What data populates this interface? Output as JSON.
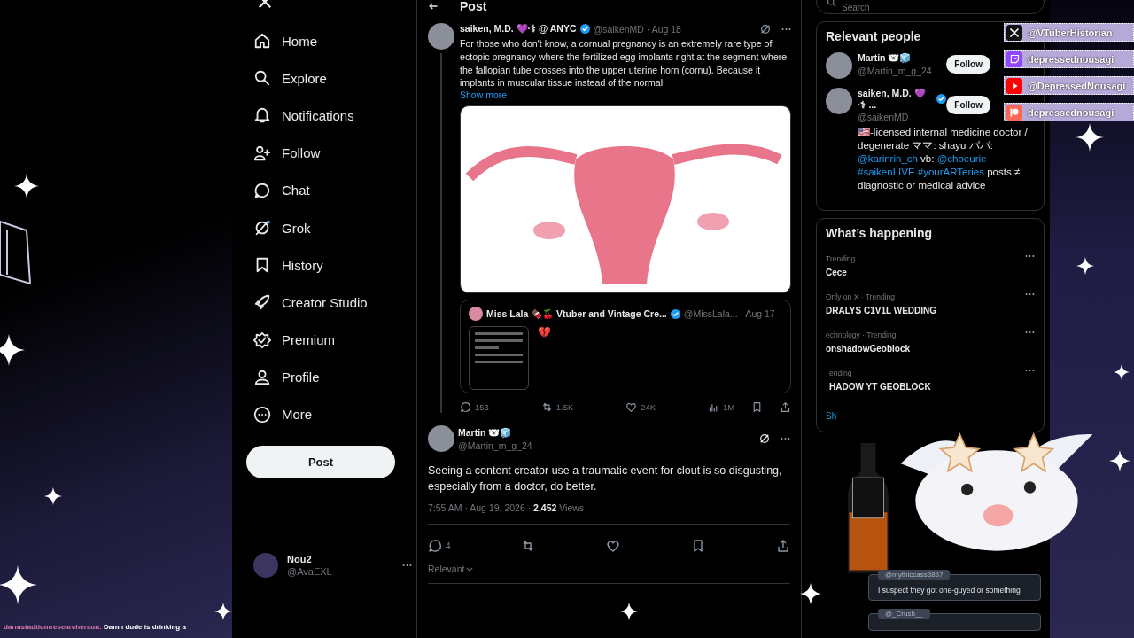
{
  "nav": {
    "items": [
      {
        "label": "Home",
        "kind": "home"
      },
      {
        "label": "Explore",
        "kind": "search"
      },
      {
        "label": "Notifications",
        "kind": "bell"
      },
      {
        "label": "Follow",
        "kind": "follow"
      },
      {
        "label": "Chat",
        "kind": "chat"
      },
      {
        "label": "Grok",
        "kind": "grok"
      },
      {
        "label": "History",
        "kind": "bookmark"
      },
      {
        "label": "Creator Studio",
        "kind": "rocket"
      },
      {
        "label": "Premium",
        "kind": "premium"
      },
      {
        "label": "Profile",
        "kind": "person"
      },
      {
        "label": "More",
        "kind": "more"
      }
    ],
    "post_button": "Post",
    "account": {
      "name": "Nou2",
      "handle": "@AvaEXL"
    }
  },
  "header": {
    "title": "Post"
  },
  "search": {
    "placeholder": "Search"
  },
  "post": {
    "name": "saiken, M.D. 💜·⚕ @ ANYC",
    "handle": "@saikenMD · Aug 18",
    "text": "For those who don't know, a cornual pregnancy is an extremely rare type of ectopic pregnancy where the fertilized egg implants right at the segment where the fallopian tube crosses into the upper uterine horn (cornu). Because it implants in muscular tissue instead of the normal",
    "show_more": "Show more",
    "quote": {
      "name": "Miss Lala 🍫🍒 Vtuber and Vintage Cre...",
      "handle": "@MissLala... · Aug 17",
      "emoji": "💔"
    },
    "stats": [
      {
        "kind": "reply",
        "count": "153"
      },
      {
        "kind": "repost",
        "count": "1.5K"
      },
      {
        "kind": "like",
        "count": "24K"
      },
      {
        "kind": "views",
        "count": "1M"
      },
      {
        "kind": "bookmark"
      },
      {
        "kind": "share"
      }
    ]
  },
  "reply": {
    "name": "Martin 🐻‍❄️🧊",
    "handle": "@Martin_m_g_24",
    "text": "Seeing a content creator use a traumatic event for clout is so disgusting, especially from a doctor, do better.",
    "time": "7:55 AM · Aug 19, 2026 · ",
    "views": "2,452",
    "views_label": "Views",
    "stats": [
      {
        "kind": "reply",
        "count": "4"
      },
      {
        "kind": "repost"
      },
      {
        "kind": "like"
      },
      {
        "kind": "bookmark"
      },
      {
        "kind": "share"
      }
    ],
    "sort": "Relevant"
  },
  "relevant_people": {
    "title": "Relevant people",
    "people": [
      {
        "name": "Martin 🐻‍❄️🧊",
        "handle": "@Martin_m_g_24",
        "button": "Follow",
        "verified": false
      },
      {
        "name": "saiken, M.D. 💜·⚕ ...",
        "handle": "@saikenMD",
        "button": "Follow",
        "verified": true,
        "bio": [
          {
            "kind": "plain",
            "text": "🇺🇸-licensed internal medicine doctor / degenerate ママ: shayu パパ: "
          },
          {
            "kind": "link",
            "text": "@karinrin_ch"
          },
          {
            "kind": "plain",
            "text": " vb: "
          },
          {
            "kind": "link",
            "text": "@choeurie"
          },
          {
            "kind": "link",
            "text": "#saikenLIVE"
          },
          {
            "kind": "link",
            "text": "#yourARTeries"
          },
          {
            "kind": "plain",
            "text": " posts ≠ diagnostic or medical advice"
          }
        ]
      }
    ]
  },
  "trending": {
    "title": "What’s happening",
    "items": [
      {
        "meta": "Trending",
        "topic": "Cece"
      },
      {
        "meta": "Only on X · Trending",
        "topic": "DRALYS C1V1L WEDDING"
      },
      {
        "meta": "echnology · Trending",
        "topic": "onshadowGeoblock"
      },
      {
        "meta": "ending",
        "topic": "HADOW YT GEOBLOCK"
      }
    ],
    "more": "Sh"
  },
  "overlay_socials": [
    {
      "kind": "x",
      "label": "@VTuberHistorian"
    },
    {
      "kind": "twitch",
      "label": "depressednousagi"
    },
    {
      "kind": "youtube",
      "label": "@DepressedNousagi"
    },
    {
      "kind": "patreon",
      "label": "depressednousagi"
    }
  ],
  "stream_chat": {
    "line": {
      "user": "darmstadtiumresearchersun:",
      "message": "Damn dude is drinking a"
    },
    "bubbles": [
      {
        "user": "@mythiccass3837",
        "message": "I suspect they got one-guyed or something"
      },
      {
        "user": "@_Crush__"
      }
    ]
  }
}
